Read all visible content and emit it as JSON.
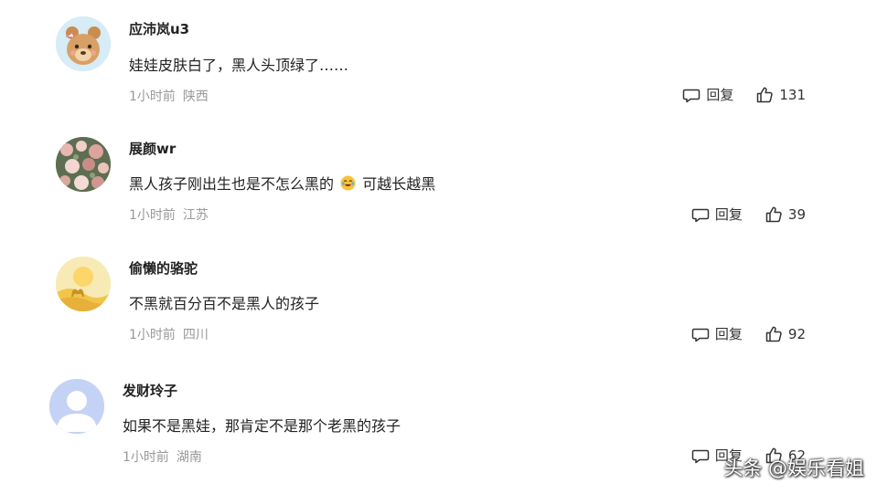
{
  "comments": [
    {
      "username": "应沛岚u3",
      "text": "娃娃皮肤白了，黑人头顶绿了……",
      "time": "1小时前",
      "location": "陕西",
      "reply_label": "回复",
      "likes": "131",
      "avatar": "bear-avatar"
    },
    {
      "username": "展颜wr",
      "text_before": "黑人孩子刚出生也是不怎么黑的",
      "emoji": "laughing-crying-emoji",
      "text_after": "可越长越黑",
      "time": "1小时前",
      "location": "江苏",
      "reply_label": "回复",
      "likes": "39",
      "avatar": "flower-avatar"
    },
    {
      "username": "偷懒的骆驼",
      "text": "不黑就百分百不是黑人的孩子",
      "time": "1小时前",
      "location": "四川",
      "reply_label": "回复",
      "likes": "92",
      "avatar": "camel-desert-avatar"
    },
    {
      "username": "发财玲子",
      "text": "如果不是黑娃，那肯定不是那个老黑的孩子",
      "time": "1小时前",
      "location": "湖南",
      "reply_label": "回复",
      "likes": "62",
      "avatar": "default-user-avatar"
    }
  ],
  "watermark": "头条 @娱乐看姐",
  "colors": {
    "text": "#222222",
    "meta": "#999999",
    "background": "#ffffff"
  }
}
